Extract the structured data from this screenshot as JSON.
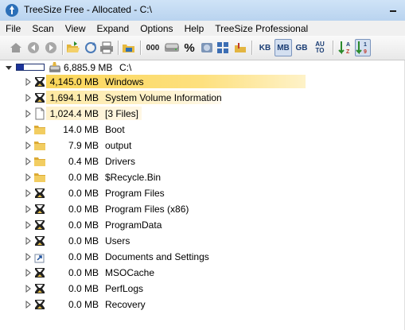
{
  "window": {
    "title": "TreeSize Free - Allocated - C:\\",
    "app_icon": "treesize-logo-icon"
  },
  "menu": [
    "File",
    "Scan",
    "View",
    "Expand",
    "Options",
    "Help",
    "TreeSize Professional"
  ],
  "toolbar": {
    "unit_kb": "KB",
    "unit_mb": "MB",
    "unit_gb": "GB",
    "unit_auto_top": "AU",
    "unit_auto_bottom": "TO",
    "format_000": "000",
    "format_percent": "%",
    "selected_unit": "MB"
  },
  "tree": {
    "root": {
      "size": "6,885.9 MB",
      "name": "C:\\",
      "usage_fraction": 0.25
    },
    "rows": [
      {
        "size": "4,145.0 MB",
        "name": "Windows",
        "icon": "hourglass-folder-icon",
        "highlight": "strong"
      },
      {
        "size": "1,694.1 MB",
        "name": "System Volume Information",
        "icon": "hourglass-folder-icon",
        "highlight": "medium"
      },
      {
        "size": "1,024.4 MB",
        "name": "[3 Files]",
        "icon": "file-icon",
        "highlight": "light"
      },
      {
        "size": "14.0 MB",
        "name": "Boot",
        "icon": "folder-icon",
        "highlight": "none"
      },
      {
        "size": "7.9 MB",
        "name": "output",
        "icon": "folder-icon",
        "highlight": "none"
      },
      {
        "size": "0.4 MB",
        "name": "Drivers",
        "icon": "folder-icon",
        "highlight": "none"
      },
      {
        "size": "0.0 MB",
        "name": "$Recycle.Bin",
        "icon": "folder-icon",
        "highlight": "none"
      },
      {
        "size": "0.0 MB",
        "name": "Program Files",
        "icon": "hourglass-folder-icon",
        "highlight": "none"
      },
      {
        "size": "0.0 MB",
        "name": "Program Files (x86)",
        "icon": "hourglass-folder-icon",
        "highlight": "none"
      },
      {
        "size": "0.0 MB",
        "name": "ProgramData",
        "icon": "hourglass-folder-icon",
        "highlight": "none"
      },
      {
        "size": "0.0 MB",
        "name": "Users",
        "icon": "hourglass-folder-icon",
        "highlight": "none"
      },
      {
        "size": "0.0 MB",
        "name": "Documents and Settings",
        "icon": "shortcut-icon",
        "highlight": "none"
      },
      {
        "size": "0.0 MB",
        "name": "MSOCache",
        "icon": "hourglass-folder-icon",
        "highlight": "none"
      },
      {
        "size": "0.0 MB",
        "name": "PerfLogs",
        "icon": "hourglass-folder-icon",
        "highlight": "none"
      },
      {
        "size": "0.0 MB",
        "name": "Recovery",
        "icon": "hourglass-folder-icon",
        "highlight": "none"
      }
    ]
  },
  "colors": {
    "highlight_strong": "#fbd65a",
    "highlight_medium": "#fde8a0",
    "highlight_light": "#fef1cb",
    "usage_bar": "#1c3399"
  }
}
